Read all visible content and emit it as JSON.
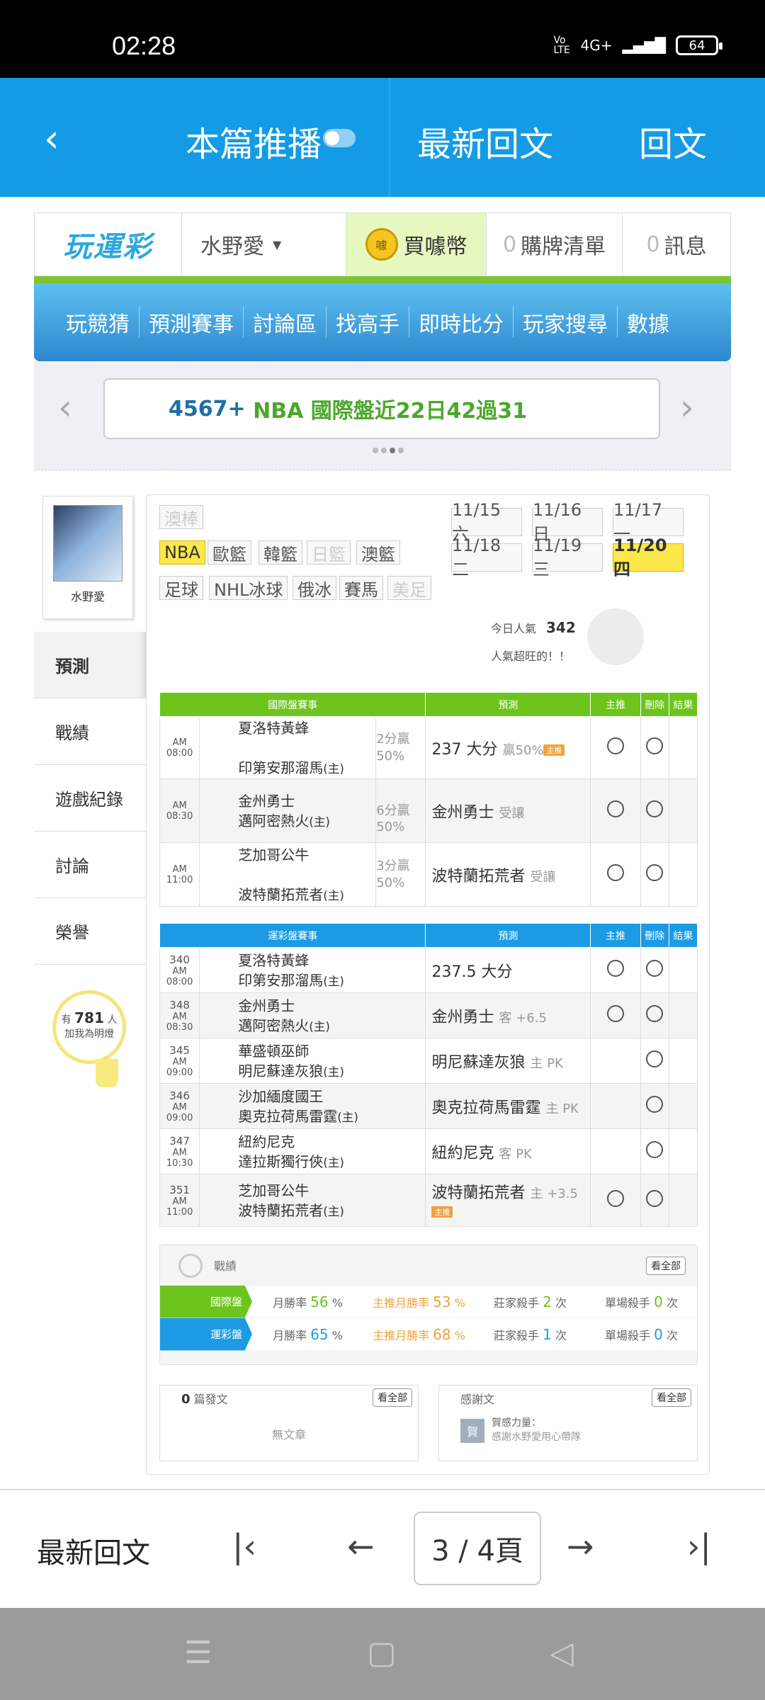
{
  "status": {
    "time": "02:28",
    "volte": "Vo LTE",
    "network": "4G+",
    "battery": "64"
  },
  "appbar": {
    "back_icon": "chevron-left-icon",
    "push_label": "本篇推播",
    "latest_label": "最新回文",
    "reply_label": "回文"
  },
  "site": {
    "logo": "玩運彩",
    "user": "水野愛",
    "coin_label": "買噱幣",
    "coin_icon": "噱",
    "cart_count": "0",
    "cart_label": "購牌清單",
    "msg_count": "0",
    "msg_label": "訊息",
    "nav": [
      "玩競猜",
      "預測賽事",
      "討論區",
      "找高手",
      "即時比分",
      "玩家搜尋",
      "數據"
    ],
    "banner": {
      "part1": "4567+",
      "part2": "NBA 國際盤近22日42過31"
    }
  },
  "profile": {
    "name": "水野愛",
    "menu": [
      "預測",
      "戰績",
      "遊戲紀錄",
      "討論",
      "榮譽"
    ],
    "fans_pre": "有",
    "fans_count": "781",
    "fans_unit": "人",
    "fans_post": "加我為明燈"
  },
  "sports": {
    "row1": [
      "澳棒"
    ],
    "row2": [
      "NBA",
      "歐籃",
      "韓籃",
      "日籃",
      "澳籃"
    ],
    "row3": [
      "足球",
      "NHL冰球",
      "俄冰",
      "賽馬",
      "美足"
    ]
  },
  "dates": [
    "11/15 六",
    "11/16 日",
    "11/17 一",
    "11/18 二",
    "11/19 三",
    "11/20 四"
  ],
  "popularity": {
    "label": "今日人氣",
    "value": "342",
    "note": "人氣超旺的！！"
  },
  "intl": {
    "headers": [
      "國際盤賽事",
      "預測",
      "主推",
      "刪除",
      "結果"
    ],
    "rows": [
      {
        "time": "AM 08:00",
        "away": "夏洛特黃蜂",
        "home": "印第安那溜馬",
        "home_tag": "(主)",
        "hcap": "2分贏",
        "pct": "50%",
        "pred": "237 大分",
        "pred_note": "贏50%",
        "badge": "主推"
      },
      {
        "time": "AM 08:30",
        "away": "金州勇士",
        "home": "邁阿密熱火",
        "home_tag": "(主)",
        "hcap": "6分贏",
        "pct": "50%",
        "pred": "金州勇士",
        "pred_note": "受讓",
        "badge": ""
      },
      {
        "time": "AM 11:00",
        "away": "芝加哥公牛",
        "home": "波特蘭拓荒者",
        "home_tag": "(主)",
        "hcap": "3分贏",
        "pct": "50%",
        "pred": "波特蘭拓荒者",
        "pred_note": "受讓",
        "badge": ""
      }
    ]
  },
  "lottery": {
    "headers": [
      "運彩盤賽事",
      "預測",
      "主推",
      "刪除",
      "結果"
    ],
    "rows": [
      {
        "no": "340",
        "time": "AM 08:00",
        "away": "夏洛特黃蜂",
        "home": "印第安那溜馬",
        "home_tag": "(主)",
        "pred": "237.5 大分",
        "pred_note": "",
        "main": true,
        "badge": ""
      },
      {
        "no": "348",
        "time": "AM 08:30",
        "away": "金州勇士",
        "home": "邁阿密熱火",
        "home_tag": "(主)",
        "pred": "金州勇士",
        "pred_note": "客 +6.5",
        "main": true,
        "badge": ""
      },
      {
        "no": "345",
        "time": "AM 09:00",
        "away": "華盛頓巫師",
        "home": "明尼蘇達灰狼",
        "home_tag": "(主)",
        "pred": "明尼蘇達灰狼",
        "pred_note": "主 PK",
        "main": false,
        "badge": ""
      },
      {
        "no": "346",
        "time": "AM 09:00",
        "away": "沙加緬度國王",
        "home": "奧克拉荷馬雷霆",
        "home_tag": "(主)",
        "pred": "奧克拉荷馬雷霆",
        "pred_note": "主 PK",
        "main": false,
        "badge": ""
      },
      {
        "no": "347",
        "time": "AM 10:30",
        "away": "紐約尼克",
        "home": "達拉斯獨行俠",
        "home_tag": "(主)",
        "pred": "紐約尼克",
        "pred_note": "客 PK",
        "main": false,
        "badge": ""
      },
      {
        "no": "351",
        "time": "AM 11:00",
        "away": "芝加哥公牛",
        "home": "波特蘭拓荒者",
        "home_tag": "(主)",
        "pred": "波特蘭拓荒者",
        "pred_note": "主 +3.5",
        "main": true,
        "badge": "主推"
      }
    ]
  },
  "record": {
    "title": "戰績",
    "view_all": "看全部",
    "rows": [
      {
        "label": "國際盤",
        "month_rate_label": "月勝率",
        "month_rate": "56",
        "main_rate_label": "主推月勝率",
        "main_rate": "53",
        "dealer_label": "莊家殺手",
        "dealer": "2",
        "single_label": "單場殺手",
        "single": "0",
        "unit_pct": "%",
        "unit_times": "次"
      },
      {
        "label": "運彩盤",
        "month_rate_label": "月勝率",
        "month_rate": "65",
        "main_rate_label": "主推月勝率",
        "main_rate": "68",
        "dealer_label": "莊家殺手",
        "dealer": "1",
        "single_label": "單場殺手",
        "single": "0",
        "unit_pct": "%",
        "unit_times": "次"
      }
    ]
  },
  "articles": {
    "count": "0",
    "label": "篇發文",
    "view_all": "看全部",
    "empty": "無文章"
  },
  "thanks": {
    "label": "感謝文",
    "view_all": "看全部",
    "avatar": "賀",
    "title": "賀感力量：",
    "text": "感謝水野愛用心帶隊"
  },
  "bottom": {
    "latest_label": "最新回文",
    "page": "3 / 4頁"
  },
  "colors": {
    "appbar": "#149be6",
    "green": "#6cc41d",
    "blue": "#1c9be4",
    "yellow": "#fde84b"
  }
}
